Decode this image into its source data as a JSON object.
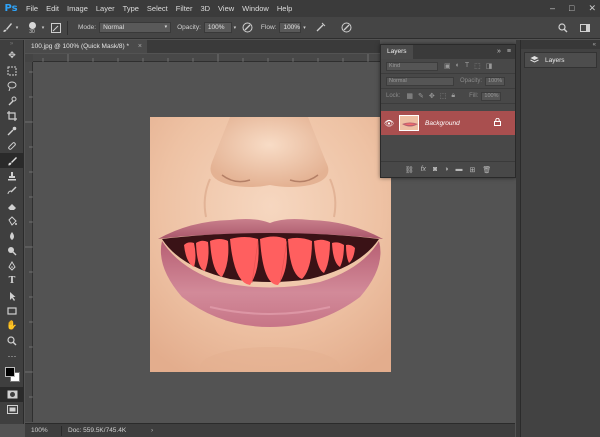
{
  "app": {
    "logo": "Ps"
  },
  "menu": [
    "File",
    "Edit",
    "Image",
    "Layer",
    "Type",
    "Select",
    "Filter",
    "3D",
    "View",
    "Window",
    "Help"
  ],
  "window_controls": {
    "minimize": "–",
    "maximize": "□",
    "close": "✕"
  },
  "options": {
    "brush_size": "30",
    "mode_label": "Mode:",
    "mode_value": "Normal",
    "opacity_label": "Opacity:",
    "opacity_value": "100%",
    "flow_label": "Flow:",
    "flow_value": "100%"
  },
  "document": {
    "tab_title": "100.jpg @ 100% (Quick Mask/8) *",
    "close": "×"
  },
  "status": {
    "zoom": "100%",
    "doc_info": "Doc: 559.5K/745.4K",
    "arrow": "›"
  },
  "layers_panel": {
    "tab": "Layers",
    "kind_placeholder": "Kind",
    "blend_mode": "Normal",
    "opacity_label": "Opacity:",
    "opacity_value": "100%",
    "lock_label": "Lock:",
    "fill_label": "Fill:",
    "fill_value": "100%",
    "layer_name": "Background"
  },
  "dock": {
    "layers_button": "Layers"
  },
  "colors": {
    "accent": "#2fa3f8",
    "layer_selected": "#a94f4f",
    "quick_mask_overlay": "#ff5a5a"
  }
}
